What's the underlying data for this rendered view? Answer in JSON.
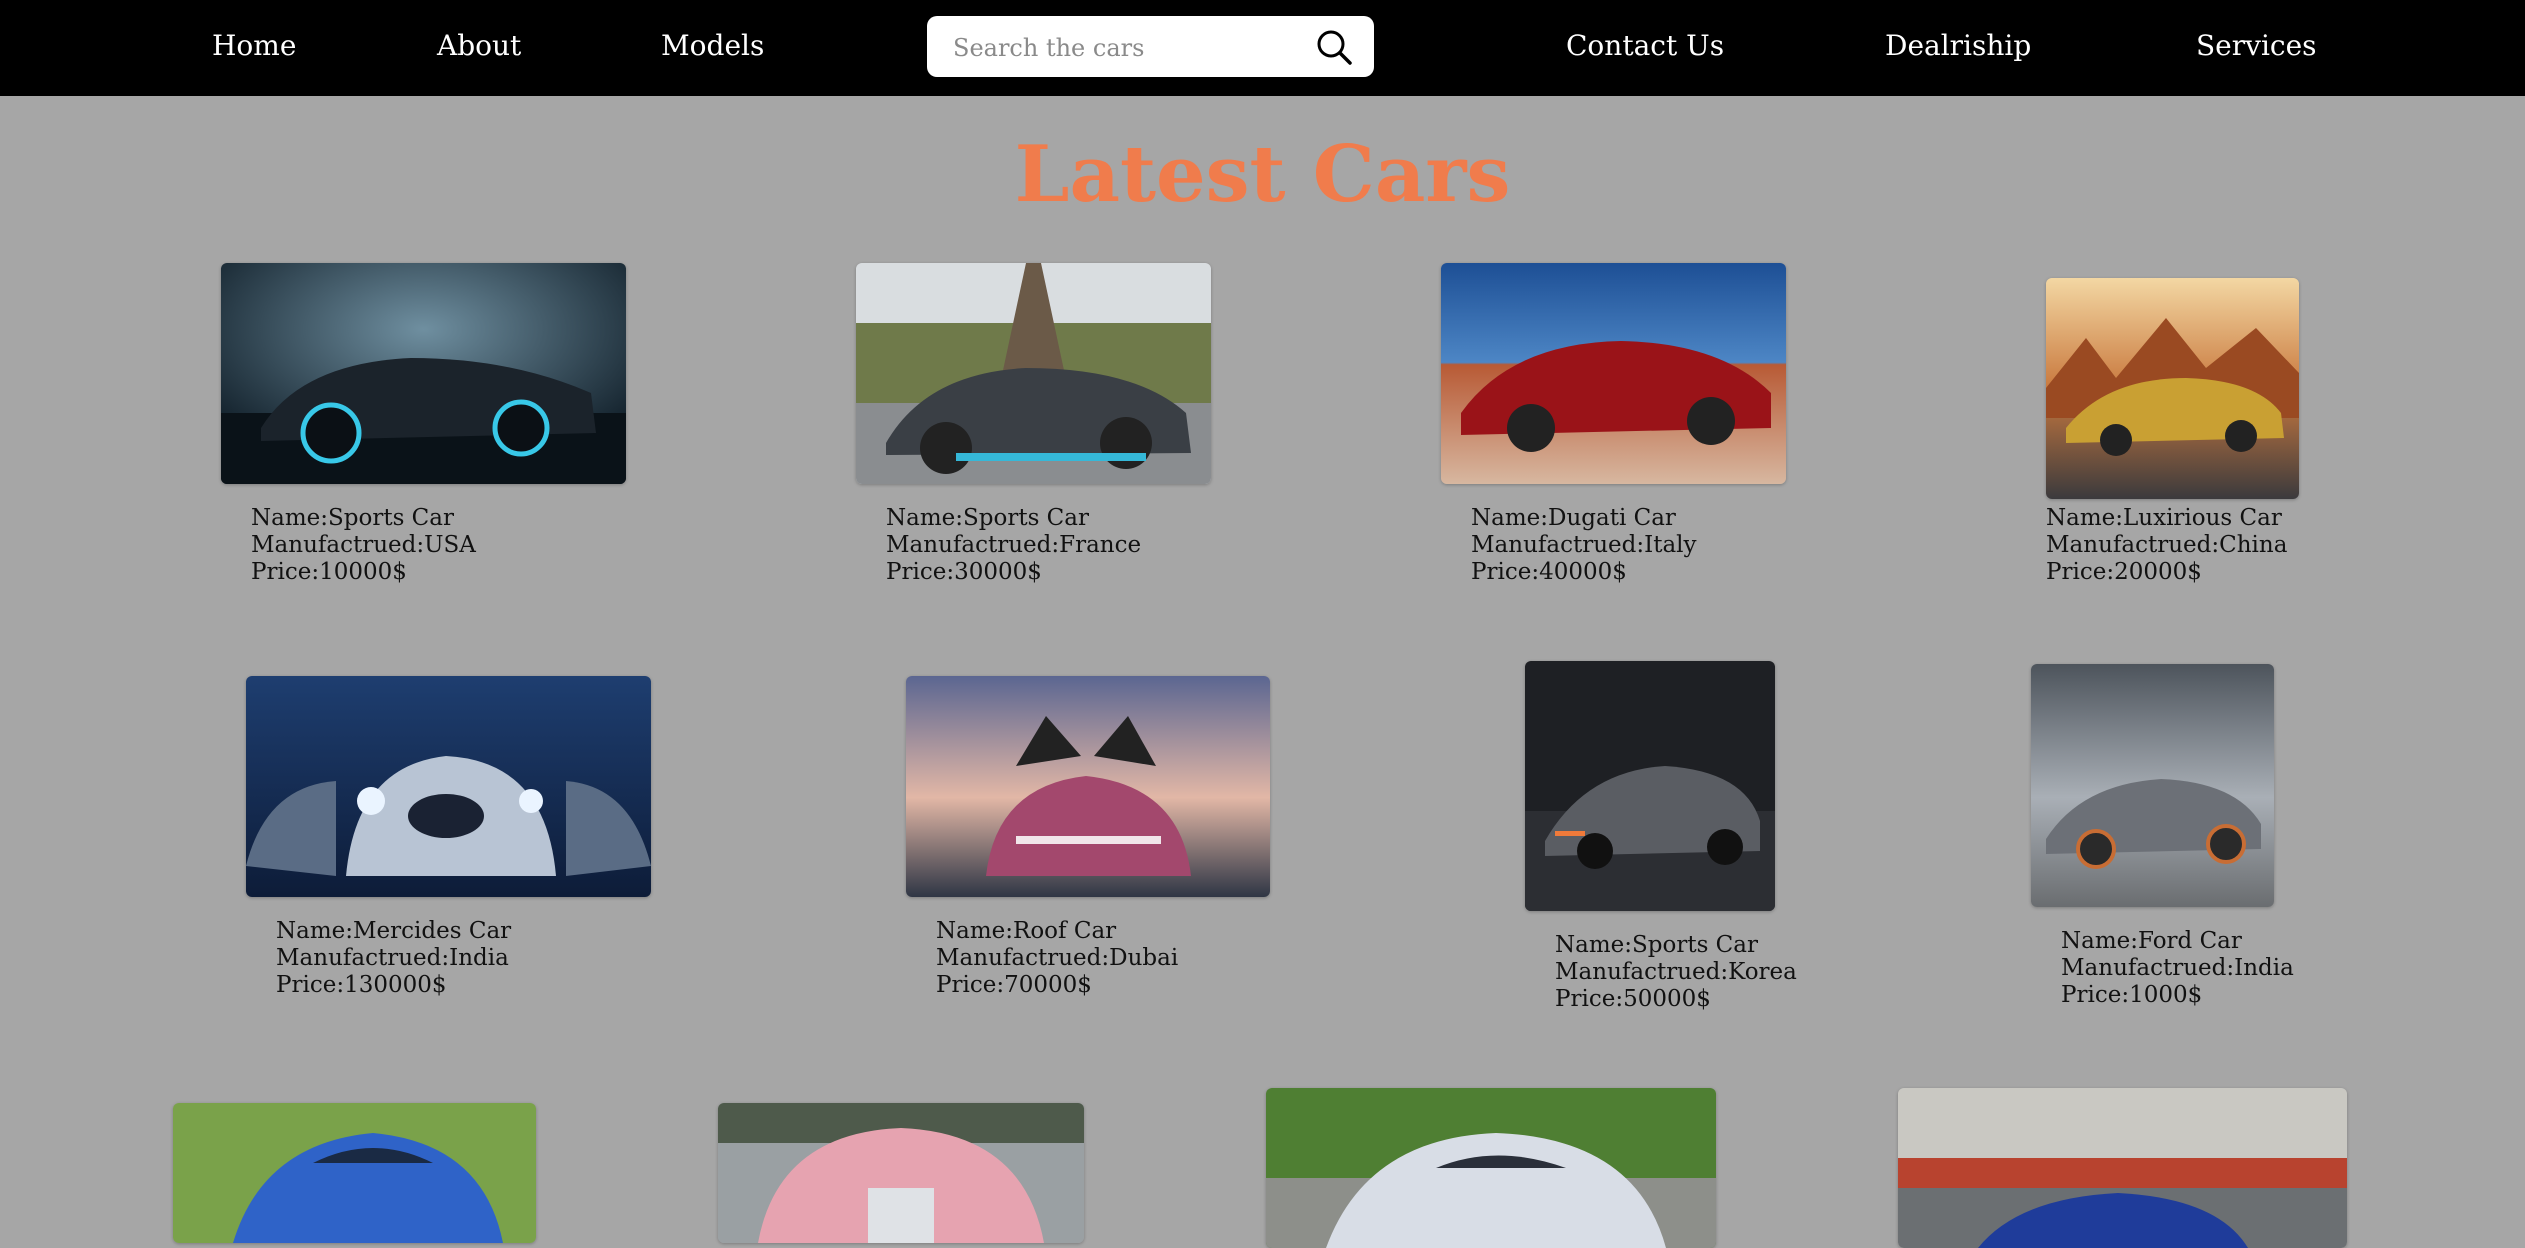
{
  "nav": {
    "home": "Home",
    "about": "About",
    "models": "Models",
    "contact": "Contact Us",
    "dealership": "Dealriship",
    "services": "Services",
    "search_placeholder": "Search the cars"
  },
  "title": "Latest Cars",
  "accent_color": "#f07c4c",
  "cars": [
    {
      "name": "Name:Sports Car",
      "made": "Manufactrued:USA",
      "price": "Price:10000$"
    },
    {
      "name": "Name:Sports Car",
      "made": "Manufactrued:France",
      "price": "Price:30000$"
    },
    {
      "name": "Name:Dugati Car",
      "made": "Manufactrued:Italy",
      "price": "Price:40000$"
    },
    {
      "name": "Name:Luxirious Car",
      "made": "Manufactrued:China",
      "price": "Price:20000$"
    },
    {
      "name": "Name:Mercides Car",
      "made": "Manufactrued:India",
      "price": "Price:130000$"
    },
    {
      "name": "Name:Roof Car",
      "made": "Manufactrued:Dubai",
      "price": "Price:70000$"
    },
    {
      "name": "Name:Sports Car",
      "made": "Manufactrued:Korea",
      "price": "Price:50000$"
    },
    {
      "name": "Name:Ford Car",
      "made": "Manufactrued:India",
      "price": "Price:1000$"
    }
  ]
}
